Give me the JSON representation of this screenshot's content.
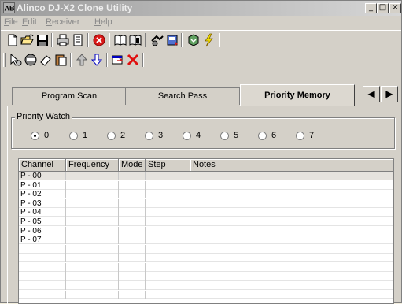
{
  "window": {
    "title": "Alinco DJ-X2 Clone Utility",
    "controls": [
      "_",
      "□",
      "×"
    ]
  },
  "menu": [
    {
      "label": "File",
      "accel": "F",
      "rest": "ile"
    },
    {
      "label": "Edit",
      "accel": "E",
      "rest": "dit"
    },
    {
      "label": "Receiver",
      "accel": "R",
      "rest": "eceiver"
    },
    {
      "label": "Help",
      "accel": "H",
      "rest": "elp"
    }
  ],
  "tabs": [
    {
      "label": "Program Scan"
    },
    {
      "label": "Search Pass"
    },
    {
      "label": "Priority Memory",
      "active": true
    }
  ],
  "tab_scroll": {
    "left": "◀",
    "right": "▶"
  },
  "priority_watch": {
    "label": "Priority Watch",
    "options": [
      "0",
      "1",
      "2",
      "3",
      "4",
      "5",
      "6",
      "7"
    ],
    "selected": "0"
  },
  "table": {
    "columns": [
      "Channel",
      "Frequency",
      "Mode",
      "Step",
      "Notes"
    ],
    "rows": [
      {
        "channel": "P - 00",
        "selected": true
      },
      {
        "channel": "P - 01"
      },
      {
        "channel": "P - 02"
      },
      {
        "channel": "P - 03"
      },
      {
        "channel": "P - 04"
      },
      {
        "channel": "P - 05"
      },
      {
        "channel": "P - 06"
      },
      {
        "channel": "P - 07"
      },
      {
        "channel": ""
      },
      {
        "channel": ""
      },
      {
        "channel": ""
      },
      {
        "channel": ""
      },
      {
        "channel": ""
      },
      {
        "channel": ""
      }
    ]
  },
  "toolbar1_icons": [
    "new-icon",
    "open-icon",
    "save-icon",
    "print-icon",
    "print-preview-icon",
    "stop-icon",
    "read-radio-icon",
    "write-radio-icon",
    "settings-icon",
    "download-icon",
    "transfer-icon",
    "lightning-icon"
  ],
  "toolbar2_icons": [
    "pointer-icon",
    "no-icon",
    "eraser-icon",
    "paste-icon",
    "move-up-icon",
    "move-down-icon",
    "insert-icon",
    "delete-icon"
  ],
  "colors": {
    "accent": "#0000c0",
    "stop": "#d81818",
    "delete": "#e01010",
    "lightning": "#f0e000"
  }
}
